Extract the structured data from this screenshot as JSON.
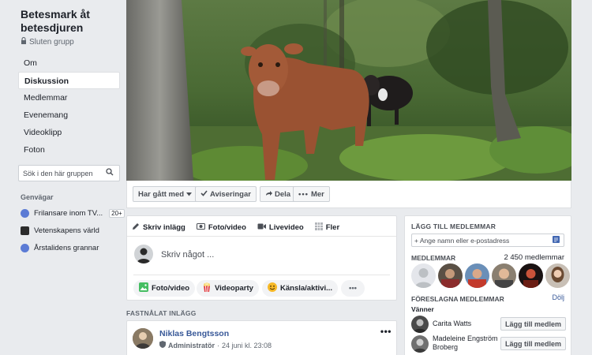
{
  "group": {
    "title": "Betesmark åt betesdjuren",
    "privacy": "Sluten grupp"
  },
  "nav": {
    "items": [
      "Om",
      "Diskussion",
      "Medlemmar",
      "Evenemang",
      "Videoklipp",
      "Foton"
    ],
    "active": "Diskussion"
  },
  "search": {
    "placeholder": "Sök i den här gruppen"
  },
  "shortcuts": {
    "title": "Genvägar",
    "items": [
      {
        "label": "Frilansare inom TV...",
        "badge": "20+",
        "icon_color": "#5b7bd5"
      },
      {
        "label": "Vetenskapens värld",
        "badge": "",
        "icon_color": "#2b2b2b"
      },
      {
        "label": "Årstalidens grannar",
        "badge": "",
        "icon_color": "#5b7bd5"
      }
    ]
  },
  "actions": {
    "joined": "Har gått med",
    "notifications": "Aviseringar",
    "share": "Dela",
    "more": "Mer"
  },
  "composer": {
    "tabs": [
      "Skriv inlägg",
      "Foto/video",
      "Livevideo",
      "Fler"
    ],
    "placeholder": "Skriv något ...",
    "pills": [
      "Foto/video",
      "Videoparty",
      "Känsla/aktivi..."
    ]
  },
  "pinned": {
    "label": "FASTNÅLAT INLÄGG",
    "author": "Niklas Bengtsson",
    "role": "Administratör",
    "date": "24 juni kl. 23:08"
  },
  "members_panel": {
    "add_title": "LÄGG TILL MEDLEMMAR",
    "add_placeholder": "+ Ange namn eller e-postadress",
    "members_title": "MEDLEMMAR",
    "members_count": "2 450 medlemmar",
    "suggested_title": "FÖRESLAGNA MEDLEMMAR",
    "hide": "Dölj",
    "friends": "Vänner",
    "suggestions": [
      {
        "name": "Carita Watts",
        "button": "Lägg till medlem"
      },
      {
        "name": "Madeleine Engström Broberg",
        "button": "Lägg till medlem"
      }
    ]
  },
  "colors": {
    "background": "#e9ebee",
    "link": "#385898",
    "cow": "#9a5232"
  }
}
